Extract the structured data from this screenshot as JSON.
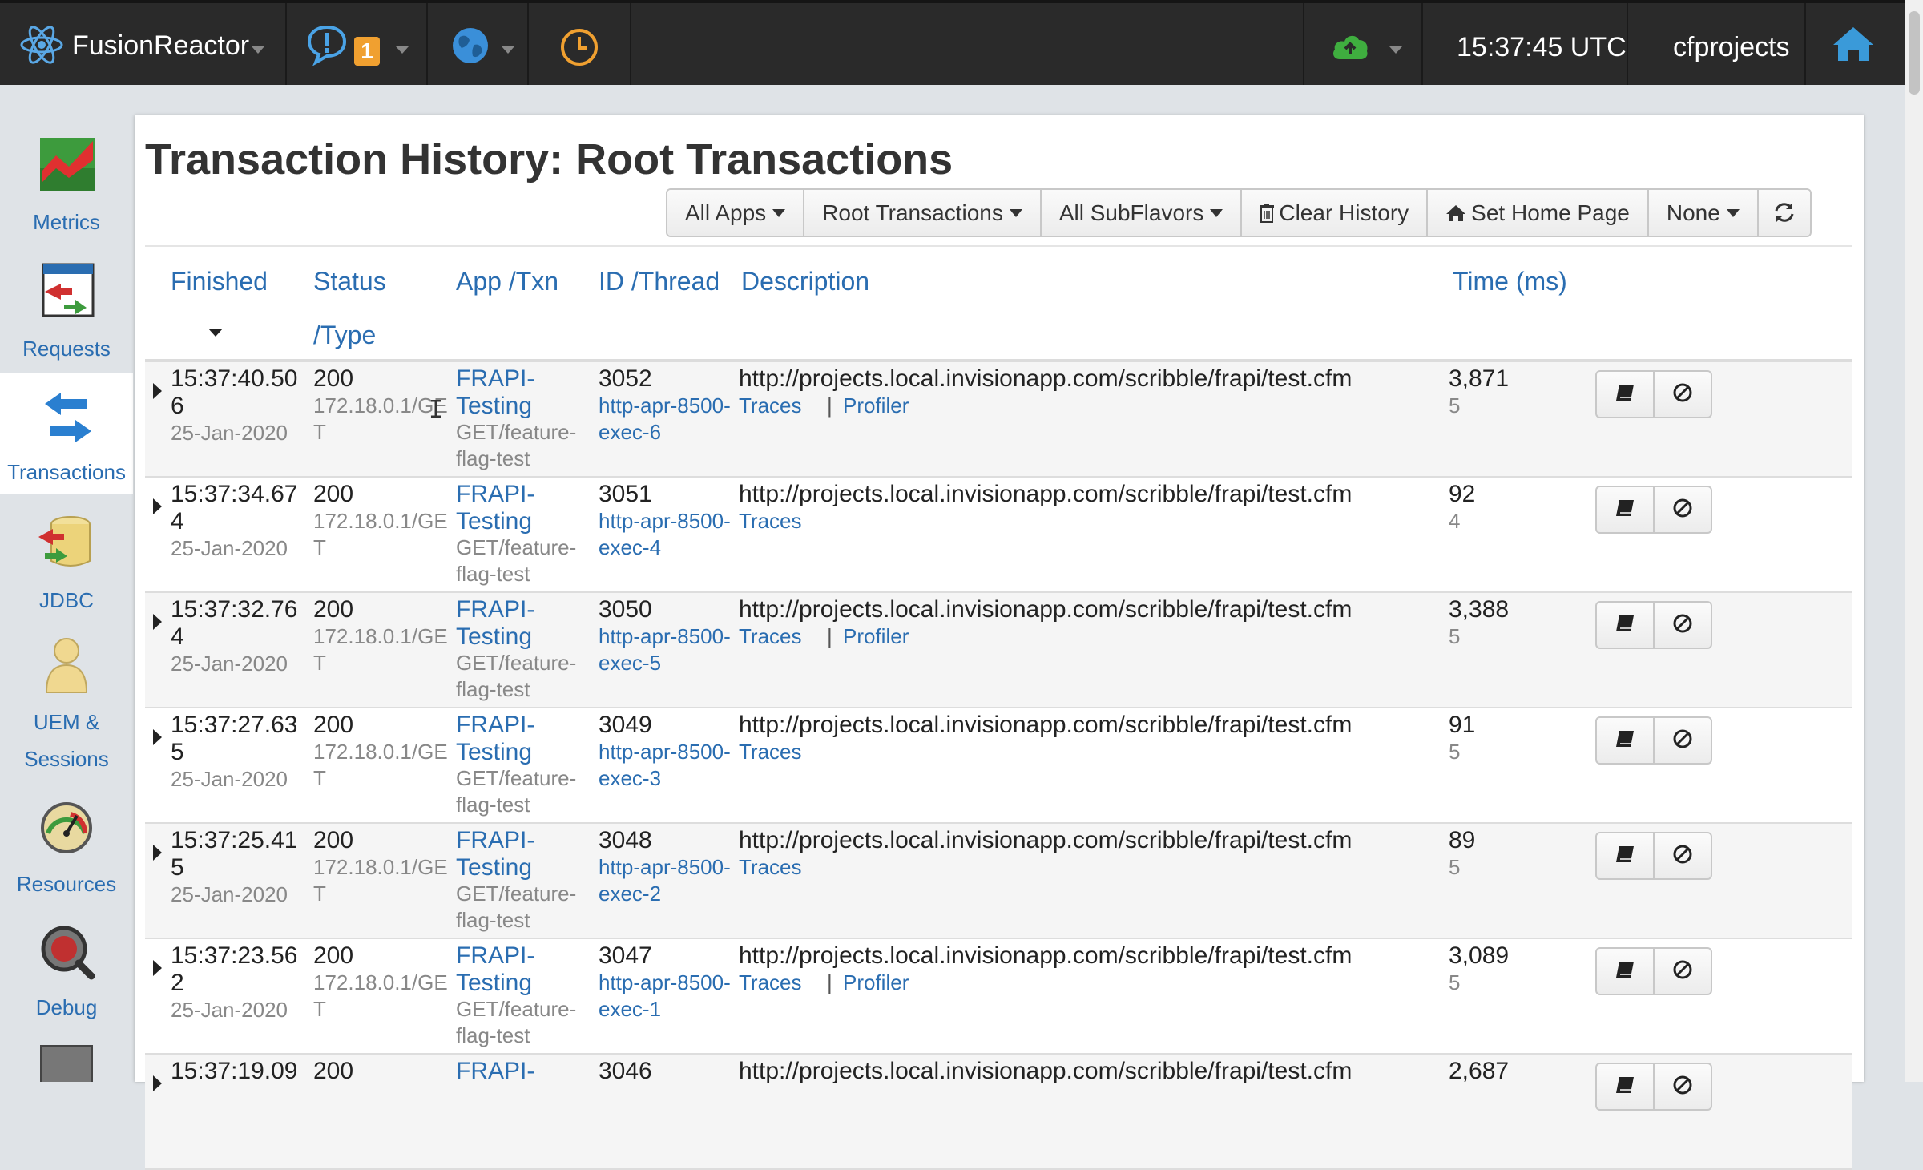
{
  "topbar": {
    "app_name": "FusionReactor",
    "notification_count": "1",
    "clock": "15:37:45 UTC",
    "instance": "cfprojects"
  },
  "sidebar": {
    "items": [
      {
        "label": "Metrics",
        "icon": "metrics-chart-icon"
      },
      {
        "label": "Requests",
        "icon": "requests-icon"
      },
      {
        "label": "Transactions",
        "icon": "transactions-arrows-icon"
      },
      {
        "label": "JDBC",
        "icon": "database-icon"
      },
      {
        "label": "UEM &",
        "label2": "Sessions",
        "icon": "user-icon"
      },
      {
        "label": "Resources",
        "icon": "gauge-icon"
      },
      {
        "label": "Debug",
        "icon": "debug-bug-icon"
      }
    ],
    "active": "Transactions"
  },
  "page": {
    "title": "Transaction History: Root Transactions"
  },
  "toolbar": {
    "all_apps": "All Apps",
    "root_transactions": "Root Transactions",
    "all_subflavors": "All SubFlavors",
    "clear_history": "Clear History",
    "set_home_page": "Set Home Page",
    "none": "None"
  },
  "table": {
    "headers": {
      "finished": "Finished",
      "status": "Status",
      "status2": "/Type",
      "app": "App /Txn",
      "id": "ID /Thread",
      "description": "Description",
      "time": "Time (ms)"
    },
    "rows": [
      {
        "time1": "15:37:40.50",
        "time2": "6",
        "date": "25-Jan-2020",
        "status": "200",
        "ip1": "172.18.0.1/GE",
        "ip2": "T",
        "app1": "FRAPI-",
        "app2": "Testing",
        "txn1": "GET/feature-",
        "txn2": "flag-test",
        "id": "3052",
        "thread1": "http-apr-8500-",
        "thread2": "exec-6",
        "url": "http://projects.local.invisionapp.com/scribble/frapi/test.cfm",
        "traces": "Traces",
        "sep": "|",
        "profiler": "Profiler",
        "ms": "3,871",
        "ms_sub": "5"
      },
      {
        "time1": "15:37:34.67",
        "time2": "4",
        "date": "25-Jan-2020",
        "status": "200",
        "ip1": "172.18.0.1/GE",
        "ip2": "T",
        "app1": "FRAPI-",
        "app2": "Testing",
        "txn1": "GET/feature-",
        "txn2": "flag-test",
        "id": "3051",
        "thread1": "http-apr-8500-",
        "thread2": "exec-4",
        "url": "http://projects.local.invisionapp.com/scribble/frapi/test.cfm",
        "traces": "Traces",
        "sep": "",
        "profiler": "",
        "ms": "92",
        "ms_sub": "4"
      },
      {
        "time1": "15:37:32.76",
        "time2": "4",
        "date": "25-Jan-2020",
        "status": "200",
        "ip1": "172.18.0.1/GE",
        "ip2": "T",
        "app1": "FRAPI-",
        "app2": "Testing",
        "txn1": "GET/feature-",
        "txn2": "flag-test",
        "id": "3050",
        "thread1": "http-apr-8500-",
        "thread2": "exec-5",
        "url": "http://projects.local.invisionapp.com/scribble/frapi/test.cfm",
        "traces": "Traces",
        "sep": "|",
        "profiler": "Profiler",
        "ms": "3,388",
        "ms_sub": "5"
      },
      {
        "time1": "15:37:27.63",
        "time2": "5",
        "date": "25-Jan-2020",
        "status": "200",
        "ip1": "172.18.0.1/GE",
        "ip2": "T",
        "app1": "FRAPI-",
        "app2": "Testing",
        "txn1": "GET/feature-",
        "txn2": "flag-test",
        "id": "3049",
        "thread1": "http-apr-8500-",
        "thread2": "exec-3",
        "url": "http://projects.local.invisionapp.com/scribble/frapi/test.cfm",
        "traces": "Traces",
        "sep": "",
        "profiler": "",
        "ms": "91",
        "ms_sub": "5"
      },
      {
        "time1": "15:37:25.41",
        "time2": "5",
        "date": "25-Jan-2020",
        "status": "200",
        "ip1": "172.18.0.1/GE",
        "ip2": "T",
        "app1": "FRAPI-",
        "app2": "Testing",
        "txn1": "GET/feature-",
        "txn2": "flag-test",
        "id": "3048",
        "thread1": "http-apr-8500-",
        "thread2": "exec-2",
        "url": "http://projects.local.invisionapp.com/scribble/frapi/test.cfm",
        "traces": "Traces",
        "sep": "",
        "profiler": "",
        "ms": "89",
        "ms_sub": "5"
      },
      {
        "time1": "15:37:23.56",
        "time2": "2",
        "date": "25-Jan-2020",
        "status": "200",
        "ip1": "172.18.0.1/GE",
        "ip2": "T",
        "app1": "FRAPI-",
        "app2": "Testing",
        "txn1": "GET/feature-",
        "txn2": "flag-test",
        "id": "3047",
        "thread1": "http-apr-8500-",
        "thread2": "exec-1",
        "url": "http://projects.local.invisionapp.com/scribble/frapi/test.cfm",
        "traces": "Traces",
        "sep": "|",
        "profiler": "Profiler",
        "ms": "3,089",
        "ms_sub": "5"
      },
      {
        "time1": "15:37:19.09",
        "time2": "",
        "date": "",
        "status": "200",
        "ip1": "",
        "ip2": "",
        "app1": "FRAPI-",
        "app2": "",
        "txn1": "",
        "txn2": "",
        "id": "3046",
        "thread1": "",
        "thread2": "",
        "url": "http://projects.local.invisionapp.com/scribble/frapi/test.cfm",
        "traces": "",
        "sep": "",
        "profiler": "",
        "ms": "2,687",
        "ms_sub": ""
      }
    ]
  },
  "colors": {
    "topbar_bg": "#2a2a2a",
    "link": "#2a6db1",
    "badge": "#f0a030",
    "cloud": "#3fae3f",
    "home": "#3a9ad9"
  }
}
